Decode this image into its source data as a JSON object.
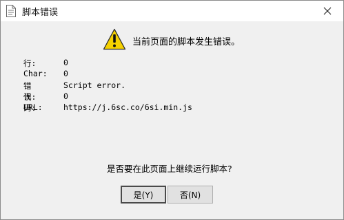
{
  "window": {
    "title": "脚本错误"
  },
  "message": "当前页面的脚本发生错误。",
  "details": [
    {
      "label": "行:",
      "value": "0"
    },
    {
      "label": "Char:",
      "value": "0"
    },
    {
      "label": "错误:",
      "value": "Script error."
    },
    {
      "label": "代码:",
      "value": "0"
    },
    {
      "label": "URL:",
      "value": "https://j.6sc.co/6si.min.js"
    }
  ],
  "question": "是否要在此页面上继续运行脚本?",
  "buttons": {
    "yes": "是(Y)",
    "no": "否(N)"
  },
  "icons": {
    "title": "document-icon",
    "warning": "warning-icon",
    "close": "close-icon"
  },
  "colors": {
    "warning_fill": "#f5d100",
    "background": "#f0f0f0"
  }
}
